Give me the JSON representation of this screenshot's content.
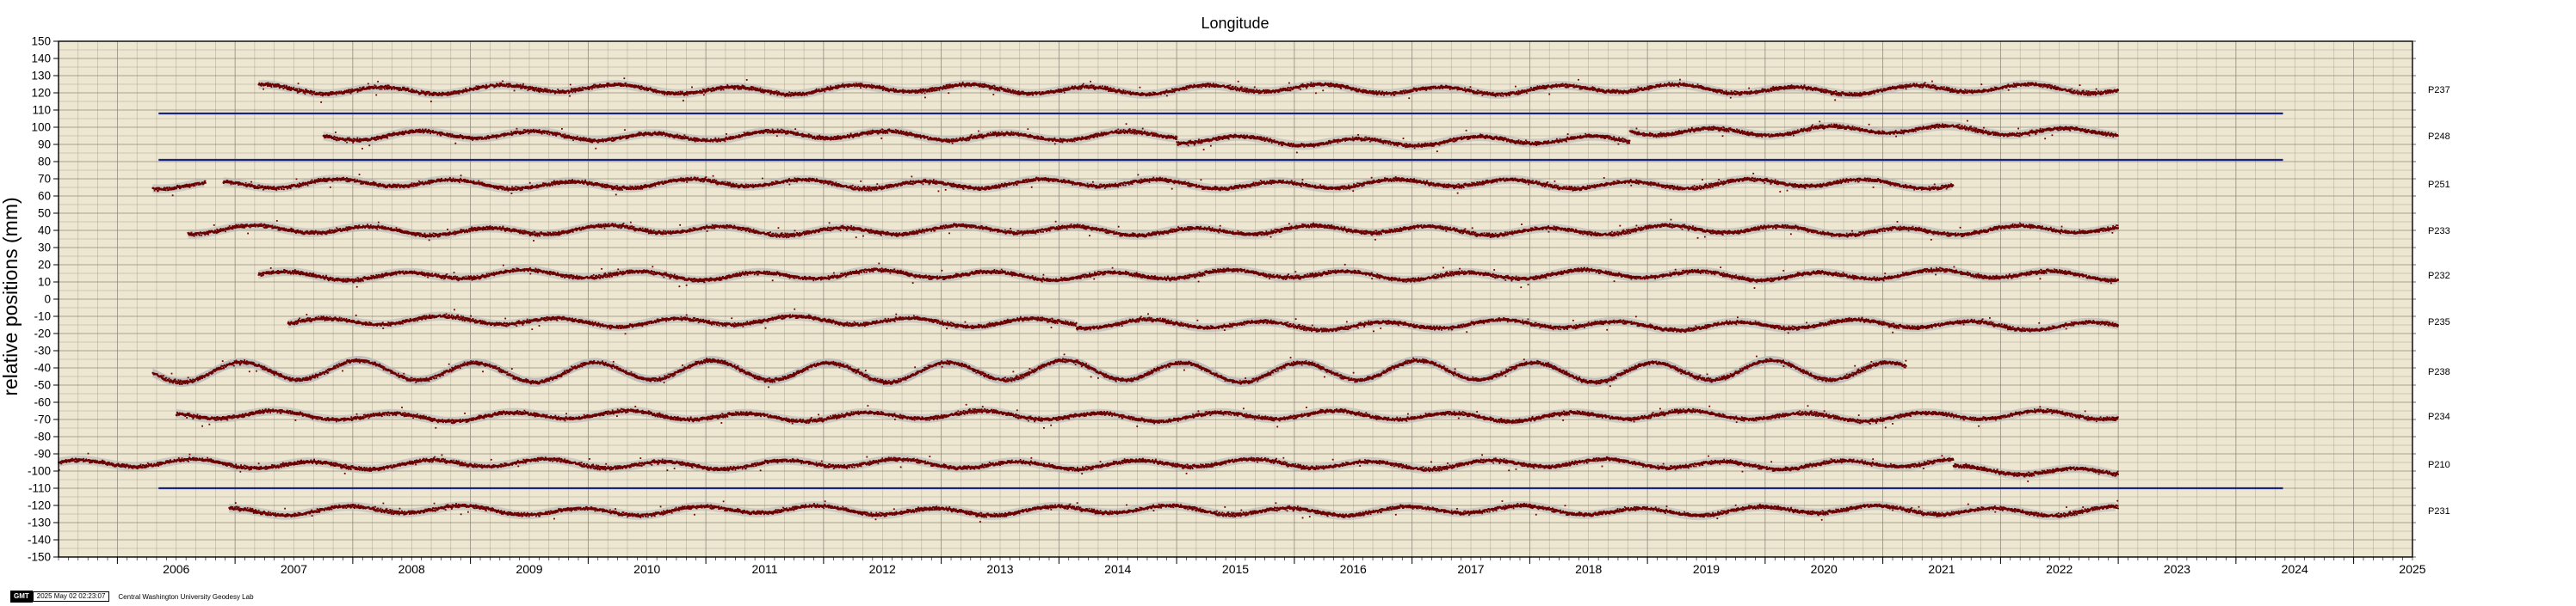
{
  "chart_data": {
    "type": "scatter",
    "title": "Longitude",
    "xlabel": "",
    "ylabel": "relative positions (mm)",
    "xlim": [
      2005.5,
      2025.5
    ],
    "ylim": [
      -150,
      150
    ],
    "x_ticks": [
      "2006",
      "2007",
      "2008",
      "2009",
      "2010",
      "2011",
      "2012",
      "2013",
      "2014",
      "2015",
      "2016",
      "2017",
      "2018",
      "2019",
      "2020",
      "2021",
      "2022",
      "2023",
      "2024",
      "2025"
    ],
    "y_ticks": [
      150,
      140,
      130,
      120,
      110,
      100,
      90,
      80,
      70,
      60,
      50,
      40,
      30,
      20,
      10,
      0,
      -10,
      -20,
      -30,
      -40,
      -50,
      -60,
      -70,
      -80,
      -90,
      -100,
      -110,
      -120,
      -130,
      -140,
      -150
    ],
    "grid": true,
    "legend": "none",
    "colors": {
      "points": "#6b0000",
      "uncertainty_band": "#b8b8b8",
      "reference_lines": "#1a237e",
      "plot_background": "#ede7d2",
      "grid": "#8f8a7a"
    },
    "series": [
      {
        "name": "P237",
        "offset": 122,
        "segments": [
          {
            "start": 2007.2,
            "end": 2023.0,
            "level": 0
          }
        ]
      },
      {
        "name": "P248",
        "offset": 95,
        "segments": [
          {
            "start": 2007.75,
            "end": 2015.0,
            "level": 0
          },
          {
            "start": 2015.0,
            "end": 2018.85,
            "level": -3
          },
          {
            "start": 2018.85,
            "end": 2023.0,
            "level": 3
          }
        ]
      },
      {
        "name": "P251",
        "offset": 67,
        "segments": [
          {
            "start": 2006.3,
            "end": 2006.75,
            "level": 0
          },
          {
            "start": 2006.9,
            "end": 2021.6,
            "level": 0
          }
        ]
      },
      {
        "name": "P233",
        "offset": 40,
        "segments": [
          {
            "start": 2006.6,
            "end": 2023.0,
            "level": 0
          }
        ]
      },
      {
        "name": "P232",
        "offset": 14,
        "segments": [
          {
            "start": 2007.2,
            "end": 2023.0,
            "level": 0
          }
        ]
      },
      {
        "name": "P235",
        "offset": -13,
        "segments": [
          {
            "start": 2007.45,
            "end": 2014.15,
            "level": 0
          },
          {
            "start": 2014.15,
            "end": 2023.0,
            "level": -2
          }
        ]
      },
      {
        "name": "P238",
        "offset": -42,
        "segments": [
          {
            "start": 2006.3,
            "end": 2021.2,
            "level": 0
          }
        ]
      },
      {
        "name": "P234",
        "offset": -68,
        "segments": [
          {
            "start": 2006.5,
            "end": 2023.0,
            "level": 0
          }
        ]
      },
      {
        "name": "P210",
        "offset": -96,
        "segments": [
          {
            "start": 2005.5,
            "end": 2021.6,
            "level": 0
          },
          {
            "start": 2021.6,
            "end": 2023.0,
            "level": -4
          }
        ]
      },
      {
        "name": "P231",
        "offset": -123,
        "segments": [
          {
            "start": 2006.95,
            "end": 2023.0,
            "level": 0
          }
        ]
      }
    ],
    "reference_lines": [
      {
        "y": 108,
        "x_start": 2006.35,
        "x_end": 2024.4
      },
      {
        "y": 81,
        "x_start": 2006.35,
        "x_end": 2024.4
      },
      {
        "y": -110,
        "x_start": 2006.35,
        "x_end": 2024.4
      }
    ]
  },
  "footer": {
    "logo": "GMT",
    "timestamp": "2025 May 02 02:23:07",
    "credit": "Central Washington University Geodesy Lab"
  }
}
